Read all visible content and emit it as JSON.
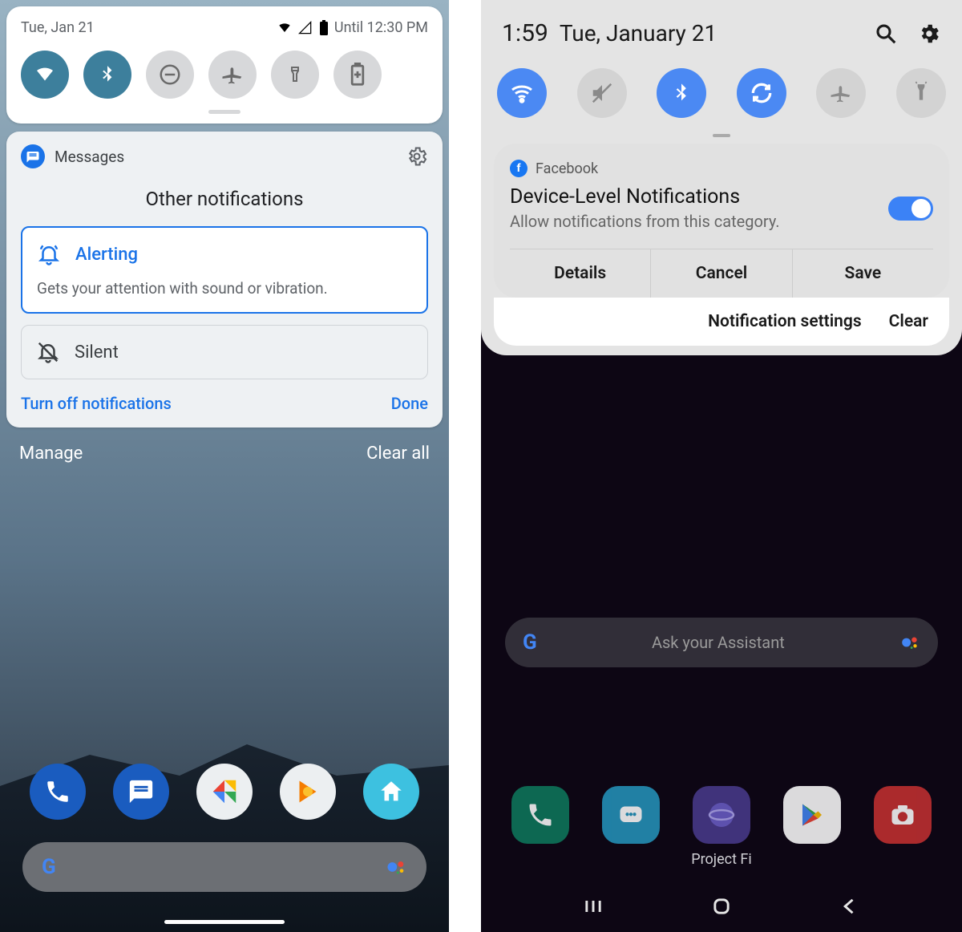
{
  "left": {
    "status": {
      "date": "Tue, Jan 21",
      "battery_until": "Until 12:30 PM"
    },
    "qs": [
      {
        "name": "wifi",
        "on": true
      },
      {
        "name": "bluetooth",
        "on": true
      },
      {
        "name": "dnd",
        "on": false
      },
      {
        "name": "airplane",
        "on": false
      },
      {
        "name": "flashlight",
        "on": false
      },
      {
        "name": "battery-saver",
        "on": false
      }
    ],
    "card": {
      "app": "Messages",
      "title": "Other notifications",
      "alerting": {
        "label": "Alerting",
        "desc": "Gets your attention with sound or vibration."
      },
      "silent": {
        "label": "Silent"
      },
      "turn_off": "Turn off notifications",
      "done": "Done"
    },
    "shade_actions": {
      "manage": "Manage",
      "clear": "Clear all"
    },
    "dock": [
      "phone",
      "messages",
      "photos",
      "play-music",
      "home"
    ]
  },
  "right": {
    "status": {
      "time": "1:59",
      "date": "Tue, January 21"
    },
    "qs": [
      {
        "name": "wifi",
        "on": true
      },
      {
        "name": "sound-mute",
        "on": false
      },
      {
        "name": "bluetooth",
        "on": true
      },
      {
        "name": "auto-rotate",
        "on": true
      },
      {
        "name": "airplane",
        "on": false
      },
      {
        "name": "flashlight",
        "on": false
      }
    ],
    "card": {
      "app": "Facebook",
      "title": "Device-Level Notifications",
      "sub": "Allow notifications from this category.",
      "toggle_on": true,
      "actions": {
        "details": "Details",
        "cancel": "Cancel",
        "save": "Save"
      }
    },
    "shade_actions": {
      "settings": "Notification settings",
      "clear": "Clear"
    },
    "search_placeholder": "Ask your Assistant",
    "dock": [
      "phone",
      "messages",
      "internet",
      "play-store",
      "camera"
    ],
    "dock_label": "Project Fi"
  }
}
